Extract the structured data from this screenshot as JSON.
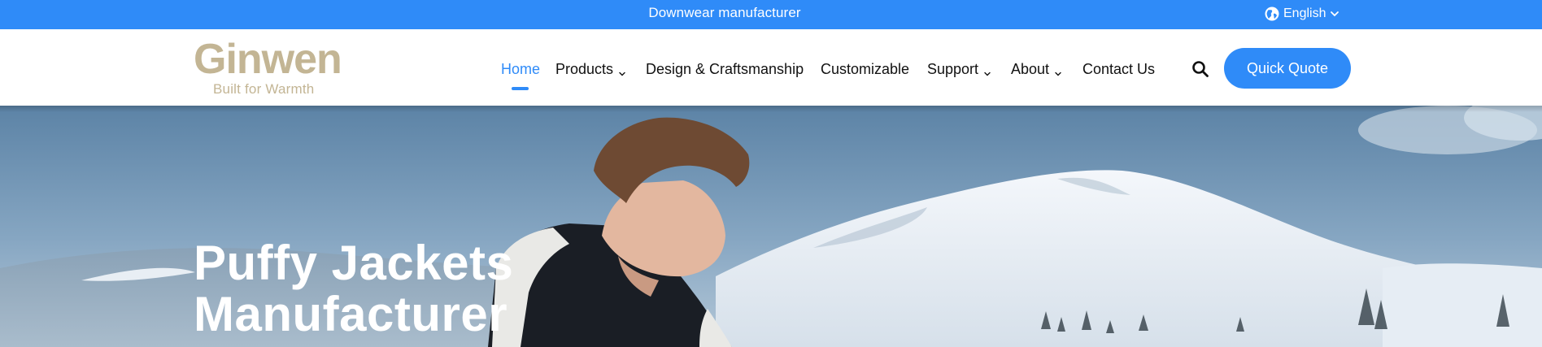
{
  "topbar": {
    "text": "Downwear manufacturer",
    "language_label": "English",
    "background": "#2f8bf8"
  },
  "logo": {
    "name": "Ginwen",
    "tagline": "Built for Warmth",
    "color": "#c3b594"
  },
  "nav": {
    "items": [
      {
        "label": "Home",
        "active": true,
        "dropdown": false
      },
      {
        "label": "Products",
        "active": false,
        "dropdown": true
      },
      {
        "label": "Design & Craftsmanship",
        "active": false,
        "dropdown": false
      },
      {
        "label": "Customizable",
        "active": false,
        "dropdown": false
      },
      {
        "label": "Support",
        "active": false,
        "dropdown": true
      },
      {
        "label": "About",
        "active": false,
        "dropdown": true
      },
      {
        "label": "Contact Us",
        "active": false,
        "dropdown": false
      }
    ],
    "accent": "#2f8bf8"
  },
  "header_actions": {
    "search_icon": "search-icon",
    "quote_label": "Quick Quote"
  },
  "hero": {
    "title_line1": "Puffy Jackets",
    "title_line2": "Manufacturer"
  }
}
